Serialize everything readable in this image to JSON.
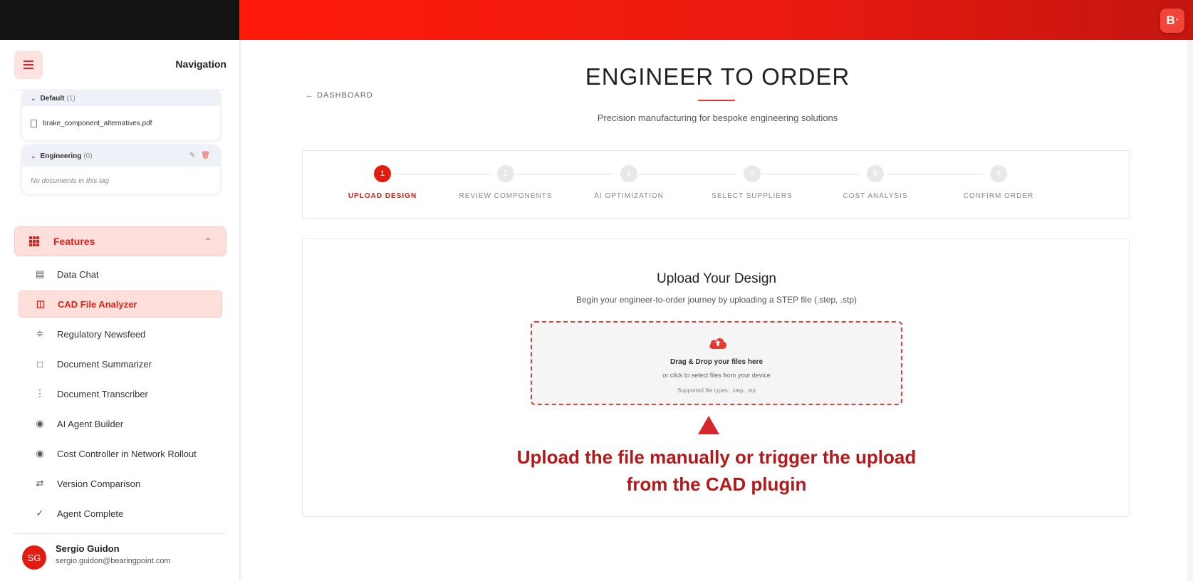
{
  "brand": {
    "logo_text": "B",
    "logo_sup": "°"
  },
  "sidebar": {
    "title": "Navigation",
    "tags": [
      {
        "name": "Default",
        "count": "(1)",
        "files": [
          "brake_component_alternatives.pdf"
        ]
      },
      {
        "name": "Engineering",
        "count": "(0)",
        "empty_text": "No documents in this tag"
      }
    ],
    "features_label": "Features",
    "features": [
      {
        "label": "Data Chat",
        "icon": "chat-icon"
      },
      {
        "label": "CAD File Analyzer",
        "icon": "chart-icon",
        "active": true
      },
      {
        "label": "Regulatory Newsfeed",
        "icon": "rss-icon"
      },
      {
        "label": "Document Summarizer",
        "icon": "document-icon"
      },
      {
        "label": "Document Transcriber",
        "icon": "waveform-icon"
      },
      {
        "label": "AI Agent Builder",
        "icon": "robot-icon"
      },
      {
        "label": "Cost Controller in Network Rollout",
        "icon": "robot-icon"
      },
      {
        "label": "Version Comparison",
        "icon": "compare-icon"
      },
      {
        "label": "Agent Complete",
        "icon": "check-circle-icon"
      }
    ],
    "user": {
      "initials": "SG",
      "name": "Sergio Guidon",
      "email": "sergio.guidon@bearingpoint.com"
    }
  },
  "main": {
    "back_label": "← DASHBOARD",
    "title": "ENGINEER TO ORDER",
    "subtitle": "Precision manufacturing for bespoke engineering solutions",
    "steps": [
      {
        "num": "1",
        "label": "UPLOAD DESIGN",
        "active": true
      },
      {
        "num": "2",
        "label": "REVIEW COMPONENTS"
      },
      {
        "num": "3",
        "label": "AI OPTIMIZATION"
      },
      {
        "num": "4",
        "label": "SELECT SUPPLIERS"
      },
      {
        "num": "5",
        "label": "COST ANALYSIS"
      },
      {
        "num": "6",
        "label": "CONFIRM ORDER"
      }
    ],
    "upload": {
      "title": "Upload Your Design",
      "description": "Begin your engineer-to-order journey by uploading a STEP file (.step, .stp)",
      "drop_title": "Drag & Drop your files here",
      "drop_sub": "or click to select files from your device",
      "drop_types": "Supported file types: .step, .stp"
    },
    "annotation_line1": "Upload the file manually or trigger the upload",
    "annotation_line2": "from the CAD plugin"
  },
  "colors": {
    "accent": "#e11d10",
    "accent_light": "#fde0dc",
    "annotation": "#b41818"
  }
}
